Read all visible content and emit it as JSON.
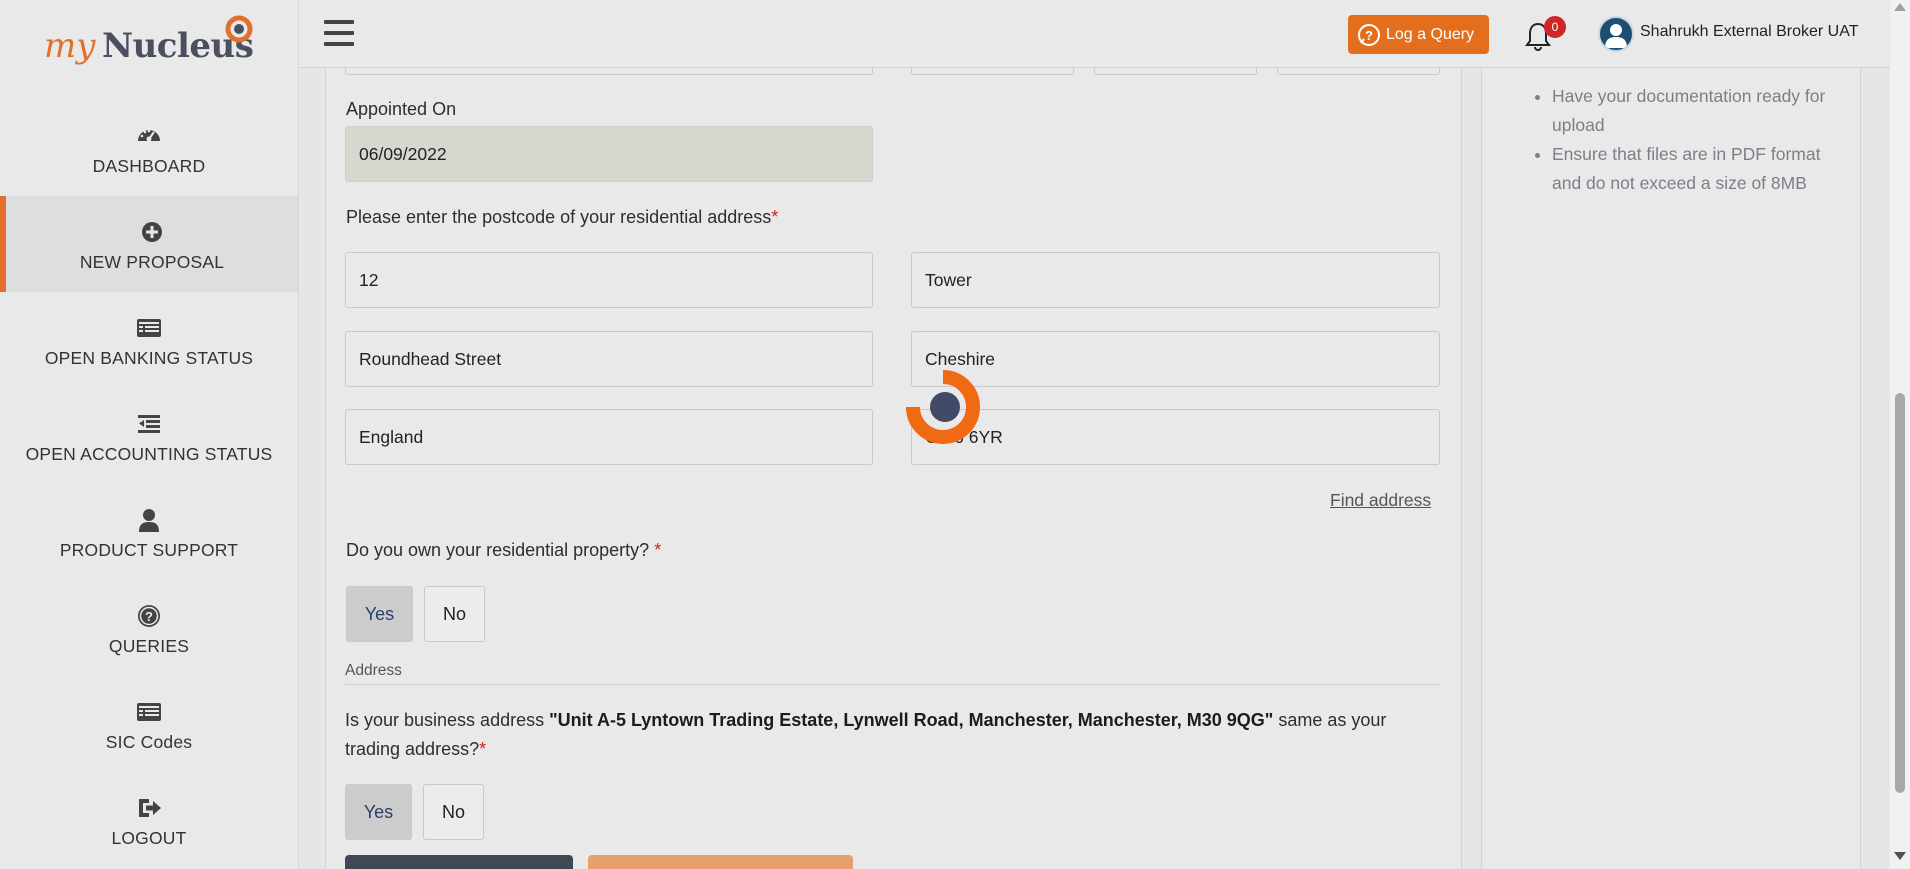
{
  "brand": {
    "logo_my": "my",
    "logo_nucleus": "Nucleus",
    "accent": "#e36f2c"
  },
  "sidebar": {
    "items": [
      {
        "label": "DASHBOARD",
        "icon": "gauge-icon",
        "active": false
      },
      {
        "label": "NEW PROPOSAL",
        "icon": "plus-circle-icon",
        "active": true
      },
      {
        "label": "OPEN BANKING STATUS",
        "icon": "list-card-icon",
        "active": false
      },
      {
        "label": "OPEN ACCOUNTING STATUS",
        "icon": "indent-list-icon",
        "active": false
      },
      {
        "label": "PRODUCT SUPPORT",
        "icon": "user-icon",
        "active": false
      },
      {
        "label": "QUERIES",
        "icon": "question-circle-icon",
        "active": false
      },
      {
        "label": "SIC Codes",
        "icon": "list-card-icon",
        "active": false
      },
      {
        "label": "LOGOUT",
        "icon": "logout-icon",
        "active": false
      }
    ]
  },
  "header": {
    "log_query_label": "Log a Query",
    "notification_count": "0",
    "user_name": "Shahrukh External Broker UAT"
  },
  "form": {
    "appointed_on_label": "Appointed On",
    "appointed_on_value": "06/09/2022",
    "postcode_label": "Please enter the postcode of your residential address",
    "required_mark": "*",
    "address_fields": {
      "house_number": "12",
      "building": "Tower",
      "street": "Roundhead Street",
      "county": "Cheshire",
      "country": "England",
      "postcode": "CW6 6YR"
    },
    "find_address_label": "Find address",
    "own_property_question": "Do you own your residential property?",
    "own_property_options": [
      "Yes",
      "No"
    ],
    "own_property_selected": "Yes",
    "address_section_title": "Address",
    "business_address_prefix": "Is your business address ",
    "business_address_value": "\"Unit A-5 Lyntown Trading Estate, Lynwell Road, Manchester, Manchester, M30 9QG\"",
    "business_address_suffix": " same as your trading address?",
    "business_address_options": [
      "Yes",
      "No"
    ],
    "business_address_selected": "Yes"
  },
  "right_panel": {
    "tips": [
      "Have your documentation ready for upload",
      "Ensure that files are in PDF format and do not exceed a size of 8MB"
    ]
  }
}
